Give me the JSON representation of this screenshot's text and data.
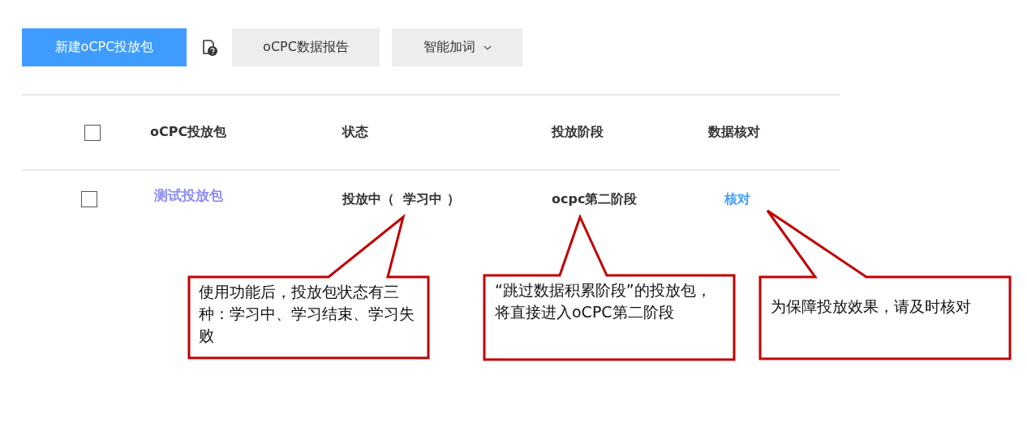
{
  "toolbar": {
    "primary_button": "新建oCPC投放包",
    "buttons": [
      {
        "label": "oCPC数据报告",
        "kind": "plain"
      },
      {
        "label": "智能加词",
        "kind": "dropdown"
      }
    ]
  },
  "table": {
    "header_checked": false,
    "columns": [
      "oCPC投放包",
      "状态",
      "投放阶段",
      "数据核对"
    ],
    "rows": [
      {
        "checked": false,
        "name": "测试投放包",
        "status": "投放中（  学习中 ）",
        "stage": "ocpc第二阶段",
        "action": "核对"
      }
    ]
  },
  "callouts": [
    {
      "text": "使用功能后，投放包状态有三种：学习中、学习结束、学习失败"
    },
    {
      "text": "“跳过数据积累阶段”的投放包，将直接进入oCPC第二阶段"
    },
    {
      "text": "为保障投放效果，请及时核对"
    }
  ]
}
